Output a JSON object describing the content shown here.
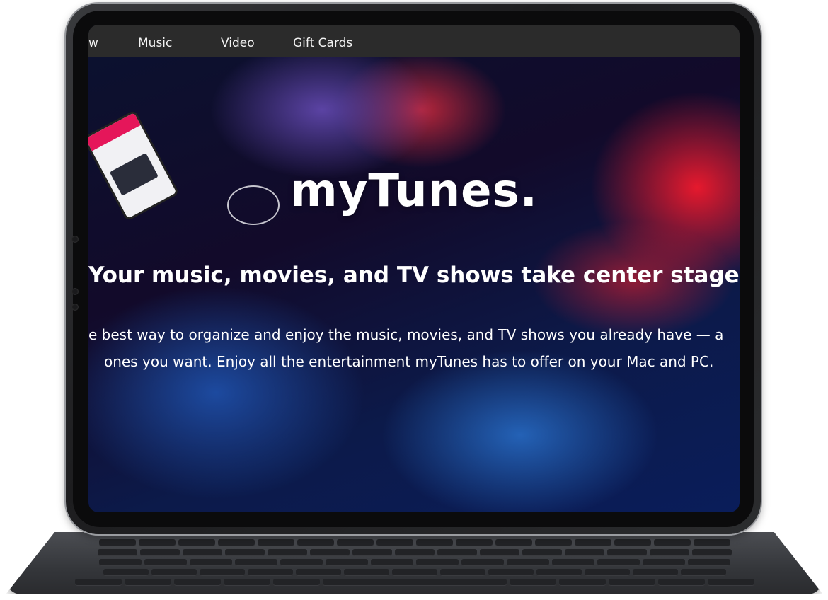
{
  "nav": {
    "items": [
      {
        "label": "w"
      },
      {
        "label": "Music"
      },
      {
        "label": "Video"
      },
      {
        "label": "Gift Cards"
      }
    ]
  },
  "hero": {
    "title": "myTunes.",
    "subtitle": "Your music, movies, and TV shows take center stage.",
    "description_line_1": "e best way to organize and enjoy the music, movies, and TV shows you already have — a",
    "description_line_2": "ones you want. Enjoy all the entertainment myTunes has to offer on your Mac and PC."
  }
}
